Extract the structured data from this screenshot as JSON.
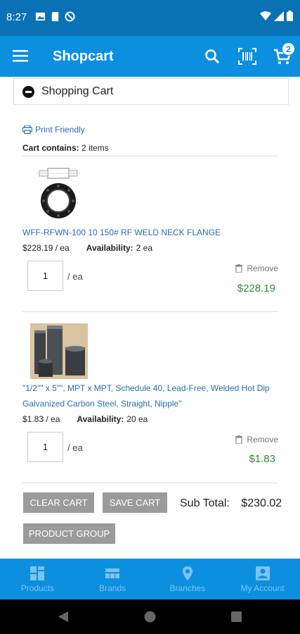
{
  "status_bar": {
    "time": "8:27"
  },
  "app_bar": {
    "title": "Shopcart",
    "cart_count": "2"
  },
  "section": {
    "title": "Shopping Cart"
  },
  "cart": {
    "print_label": "Print Friendly",
    "contains_label": "Cart contains:",
    "contains_value": "2 items",
    "items": [
      {
        "name": "WFF-RFWN-100 10 150# RF WELD NECK FLANGE",
        "unit_price": "$228.19 / ea",
        "availability_label": "Availability:",
        "availability_value": "2 ea",
        "quantity": "1",
        "unit": "/  ea",
        "remove_label": "Remove",
        "line_total": "$228.19"
      },
      {
        "name": "\"1/2\"\" x 5\"\", MPT x MPT, Schedule 40, Lead-Free, Welded Hot Dip Galvanized Carbon Steel, Straight, Nipple\"",
        "unit_price": "$1.83 / ea",
        "availability_label": "Availability:",
        "availability_value": "20 ea",
        "quantity": "1",
        "unit": "/  ea",
        "remove_label": "Remove",
        "line_total": "$1.83"
      }
    ],
    "buttons": {
      "clear": "CLEAR CART",
      "save": "SAVE CART",
      "product_group": "PRODUCT GROUP"
    },
    "subtotal_label": "Sub Total:",
    "subtotal_value": "$230.02"
  },
  "bottom_nav": [
    {
      "label": "Products",
      "icon": "grid-icon"
    },
    {
      "label": "Brands",
      "icon": "brands-icon"
    },
    {
      "label": "Branches",
      "icon": "location-pin-icon"
    },
    {
      "label": "My Account",
      "icon": "account-icon"
    }
  ],
  "colors": {
    "status_bar": "#0a71b5",
    "app_bar": "#0d8fe0",
    "link": "#2a6db0",
    "total_green": "#2e8b2e",
    "button_gray": "#9b9b9b"
  }
}
